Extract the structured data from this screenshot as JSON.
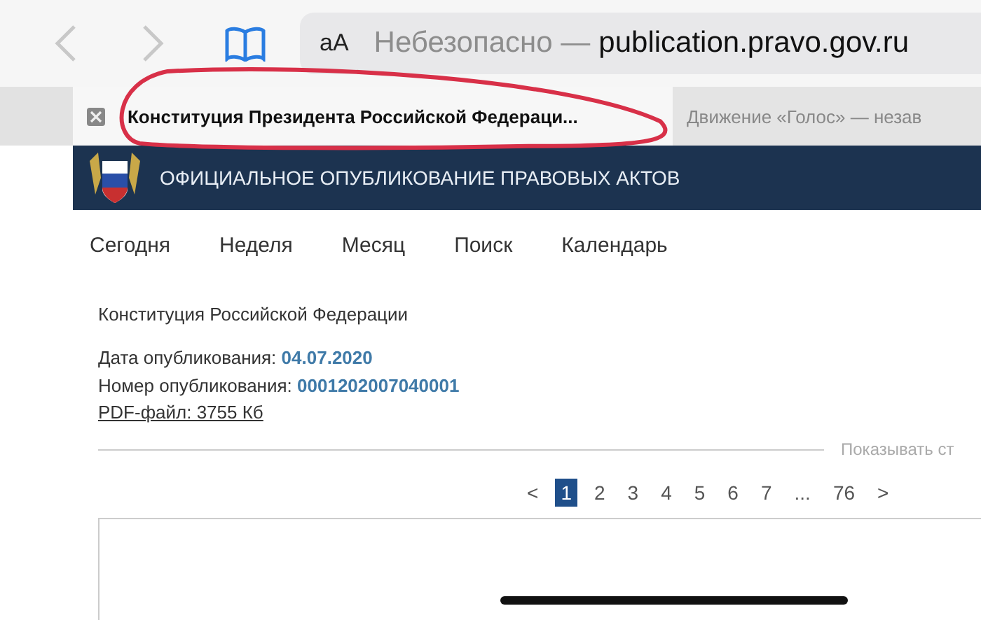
{
  "toolbar": {
    "back": {
      "disabled": true
    },
    "forward": {
      "disabled": true
    },
    "text_size": "aA",
    "address": {
      "security": "Небезопасно —",
      "host": "publication.pravo.gov.ru"
    }
  },
  "tabs": [
    {
      "title": "Конституция Президента Российской Федераци...",
      "selected": true,
      "annotated": true
    },
    {
      "title": "Движение «Голос» — незав",
      "selected": false,
      "annotated": false
    }
  ],
  "site_header": {
    "title": "ОФИЦИАЛЬНОЕ ОПУБЛИКОВАНИЕ ПРАВОВЫХ АКТОВ"
  },
  "nav": [
    "Сегодня",
    "Неделя",
    "Месяц",
    "Поиск",
    "Календарь"
  ],
  "document": {
    "title": "Конституция Российской Федерации",
    "fields": [
      {
        "label": "Дата опубликования:",
        "value": "04.07.2020"
      },
      {
        "label": "Номер опубликования:",
        "value": "0001202007040001"
      }
    ],
    "pdf_link": "PDF-файл: 3755 Кб"
  },
  "show_label": "Показывать ст",
  "pagination": {
    "prev": "<",
    "next": ">",
    "items": [
      {
        "label": "1",
        "selected": true
      },
      {
        "label": "2",
        "selected": false
      },
      {
        "label": "3",
        "selected": false
      },
      {
        "label": "4",
        "selected": false
      },
      {
        "label": "5",
        "selected": false
      },
      {
        "label": "6",
        "selected": false
      },
      {
        "label": "7",
        "selected": false
      },
      {
        "label": "...",
        "selected": false
      },
      {
        "label": "76",
        "selected": false
      }
    ]
  }
}
